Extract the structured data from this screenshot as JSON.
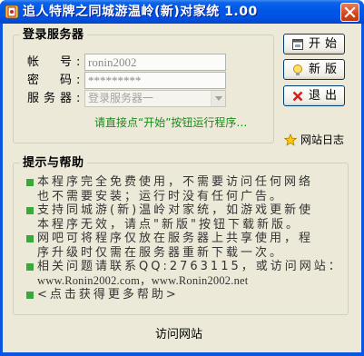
{
  "window": {
    "title": "追人特牌之同城游温岭(新)对家统 1.00",
    "icon": "app-icon",
    "close_icon": "close-icon",
    "title_bar_color": "#0054E3",
    "background_color": "#ECE9D8"
  },
  "login": {
    "title": "登录服务器",
    "account_label": "帐　号:",
    "account_value": "ronin2002",
    "password_label": "密　码:",
    "password_value": "*********",
    "server_label": "服务器:",
    "server_selected": "登录服务器一",
    "hint": "请直接点“开始”按钮运行程序…",
    "hint_color": "#1A8A1A"
  },
  "buttons": {
    "start": {
      "label": "开始",
      "icon": "start-icon"
    },
    "new_version": {
      "label": "新版",
      "icon": "lightbulb-icon"
    },
    "exit": {
      "label": "退出",
      "icon": "red-x-icon"
    }
  },
  "site_log": {
    "label": "网站日志",
    "icon": "star-icon"
  },
  "help": {
    "title": "提示与帮助",
    "bullet_color": "#3AA83A",
    "items": [
      {
        "lines": [
          "本程序完全免费使用，不需要访问任何网络",
          "也不需要安装；运行时没有任何广告。"
        ]
      },
      {
        "lines": [
          "支持同城游(新)温岭对家统，如游戏更新使",
          "本程序无效，请点\"新版\"按钮下载新版。"
        ]
      },
      {
        "lines": [
          "网吧可将程序仅放在服务器上共享使用，程",
          "序升级时仅需在服务器重新下载一次。"
        ]
      },
      {
        "lines": [
          "相关问题请联系QQ:2763115，或访问网站：",
          "www.Ronin2002.com，www.Ronin2002.net"
        ]
      },
      {
        "lines": [
          "<点击获得更多帮助>"
        ]
      }
    ]
  },
  "footer": {
    "visit_site": "访问网站"
  }
}
